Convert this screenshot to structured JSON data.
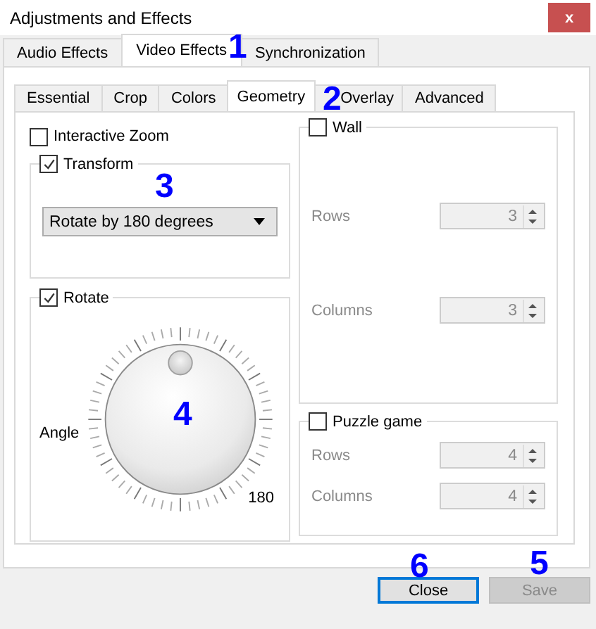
{
  "window": {
    "title": "Adjustments and Effects",
    "close": "x"
  },
  "tabs": [
    {
      "label": "Audio Effects",
      "selected": false
    },
    {
      "label": "Video Effects",
      "selected": true
    },
    {
      "label": "Synchronization",
      "selected": false
    }
  ],
  "subtabs": [
    {
      "label": "Essential",
      "selected": false
    },
    {
      "label": "Crop",
      "selected": false
    },
    {
      "label": "Colors",
      "selected": false
    },
    {
      "label": "Geometry",
      "selected": true
    },
    {
      "label": "Overlay",
      "selected": false
    },
    {
      "label": "Advanced",
      "selected": false
    }
  ],
  "interactive_zoom": {
    "label": "Interactive Zoom",
    "checked": false
  },
  "transform": {
    "label": "Transform",
    "checked": true,
    "dropdown": {
      "value": "Rotate by 180 degrees"
    }
  },
  "rotate": {
    "label": "Rotate",
    "checked": true,
    "angle_label": "Angle",
    "reading": "180"
  },
  "wall": {
    "label": "Wall",
    "checked": false,
    "fields": [
      {
        "label": "Rows",
        "value": "3"
      },
      {
        "label": "Columns",
        "value": "3"
      }
    ]
  },
  "puzzle": {
    "label": "Puzzle game",
    "checked": false,
    "fields": [
      {
        "label": "Rows",
        "value": "4"
      },
      {
        "label": "Columns",
        "value": "4"
      }
    ]
  },
  "buttons": [
    {
      "label": "Close",
      "focused": true,
      "disabled": false
    },
    {
      "label": "Save",
      "focused": false,
      "disabled": true
    }
  ],
  "annotations": [
    "1",
    "2",
    "3",
    "4",
    "6",
    "5"
  ]
}
